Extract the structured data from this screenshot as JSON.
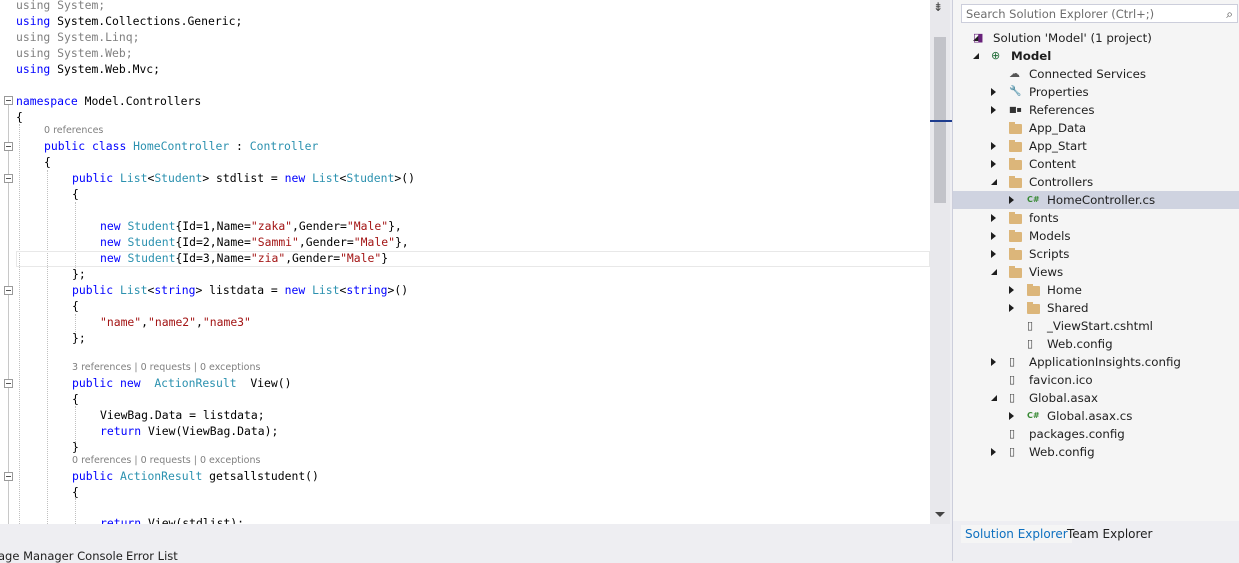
{
  "code_lines": {
    "l1": {
      "kw": "using",
      "rest": " System;",
      "dim": true
    },
    "l2": {
      "kw": "using",
      "rest": " System.Collections.Generic;",
      "dim": false
    },
    "l3": {
      "kw": "using",
      "rest": " System.Linq;",
      "dim": true
    },
    "l4": {
      "kw": "using",
      "rest": " System.Web;",
      "dim": true
    },
    "l5": {
      "kw": "using",
      "rest": " System.Web.Mvc;",
      "dim": false
    }
  },
  "code": {
    "ns_kw": "namespace",
    "ns_name": " Model.Controllers",
    "brace_open": "{",
    "brace_close": "}",
    "brace_close_semi": "};",
    "lens1": "0 references",
    "class_kw1": "public",
    "class_kw2": "class",
    "class_name": "HomeController",
    "class_colon": " : ",
    "class_base": "Controller",
    "f1_kw": "public",
    "f1_t1": "List",
    "f1_lt": "<",
    "f1_t2": "Student",
    "f1_gt": "> stdlist = ",
    "f1_new": "new",
    "f1_t3": "List",
    "f1_t4": "Student",
    "f1_end": ">()",
    "s1_new": "new",
    "s1_type": "Student",
    "s1_a": "{Id=1,Name=",
    "s1_name": "\"zaka\"",
    "s1_b": ",Gender=",
    "s1_g": "\"Male\"",
    "s1_c": "},",
    "s2_a": "{Id=2,Name=",
    "s2_name": "\"Sammi\"",
    "s3_a": "{Id=3,Name=",
    "s3_name": "\"zia\"",
    "s3_c": "}",
    "f2_t2": "string",
    "f2_gt": "> listdata = ",
    "str_list_a": "\"name\"",
    "str_list_b": "\"name2\"",
    "str_list_c": "\"name3\"",
    "comma": ",",
    "lens2": "3 references | 0 requests | 0 exceptions",
    "m1_kw2": "new",
    "m1_type": "ActionResult",
    "m1_name": "View()",
    "m1_body1": "ViewBag.Data = listdata;",
    "m1_ret": "return",
    "m1_body2": " View(ViewBag.Data);",
    "lens3": "0 references | 0 requests | 0 exceptions",
    "m2_name": " getsallstudent()",
    "m2_body": " View(stdlist);"
  },
  "bottom_tabs": [
    "age Manager Console",
    "Error List"
  ],
  "solution_explorer": {
    "search_placeholder": "Search Solution Explorer (Ctrl+;)",
    "nodes": [
      {
        "label": "Solution 'Model' (1 project)",
        "icon": "solution-icon"
      },
      {
        "label": "Model",
        "icon": "web-project-icon",
        "bold": true
      },
      {
        "label": "Connected Services",
        "icon": "cloud-icon"
      },
      {
        "label": "Properties",
        "icon": "wrench-icon"
      },
      {
        "label": "References",
        "icon": "references-icon"
      },
      {
        "label": "App_Data",
        "icon": "folder-icon"
      },
      {
        "label": "App_Start",
        "icon": "folder-icon"
      },
      {
        "label": "Content",
        "icon": "folder-icon"
      },
      {
        "label": "Controllers",
        "icon": "folder-open-icon"
      },
      {
        "label": "HomeController.cs",
        "icon": "csharp-file-icon"
      },
      {
        "label": "fonts",
        "icon": "folder-icon"
      },
      {
        "label": "Models",
        "icon": "folder-icon"
      },
      {
        "label": "Scripts",
        "icon": "folder-icon"
      },
      {
        "label": "Views",
        "icon": "folder-open-icon"
      },
      {
        "label": "Home",
        "icon": "folder-icon"
      },
      {
        "label": "Shared",
        "icon": "folder-icon"
      },
      {
        "label": "_ViewStart.cshtml",
        "icon": "razor-file-icon"
      },
      {
        "label": "Web.config",
        "icon": "config-file-icon"
      },
      {
        "label": "ApplicationInsights.config",
        "icon": "config-file-icon"
      },
      {
        "label": "favicon.ico",
        "icon": "image-file-icon"
      },
      {
        "label": "Global.asax",
        "icon": "asax-file-icon"
      },
      {
        "label": "Global.asax.cs",
        "icon": "csharp-file-icon"
      },
      {
        "label": "packages.config",
        "icon": "config-file-icon"
      },
      {
        "label": "Web.config",
        "icon": "config-file-icon"
      }
    ],
    "tabs": [
      "Solution Explorer",
      "Team Explorer"
    ]
  },
  "colors": {
    "keyword": "#0000ff",
    "type": "#2b91af",
    "string": "#a31515",
    "accent": "#1e3c8e",
    "folder": "#dcb67a"
  }
}
